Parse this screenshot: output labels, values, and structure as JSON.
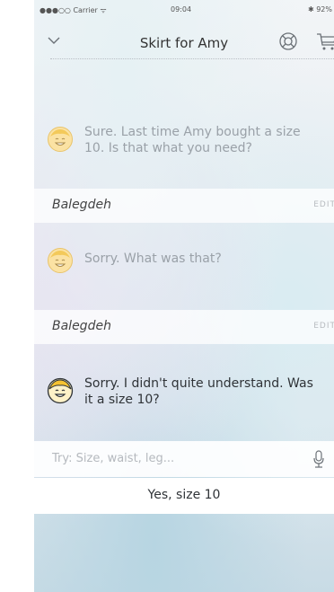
{
  "status_bar": {
    "carrier": "●●●○○ Carrier ᯤ",
    "time": "09:04",
    "battery": "✱ 92%"
  },
  "nav": {
    "title": "Skirt for Amy",
    "icons": {
      "back": "chevron-down-icon",
      "support": "lifebuoy-icon",
      "cart": "cart-icon"
    }
  },
  "conversation": [
    {
      "text": "Sure. Last time Amy bought a size 10. Is that what you need?",
      "reply": {
        "name": "Balegdeh",
        "action": "EDIT"
      }
    },
    {
      "text": "Sorry. What was that?",
      "reply": {
        "name": "Balegdeh",
        "action": "EDIT"
      }
    },
    {
      "text": "Sorry. I didn't quite understand. Was it a size 10?"
    }
  ],
  "input": {
    "placeholder": "Try: Size, waist, leg..."
  },
  "suggestion": {
    "label": "Yes, size 10"
  },
  "colors": {
    "avatar_yellow": "#f6c232",
    "inactive_text": "#9aa1a8",
    "active_text": "#2f3337"
  }
}
